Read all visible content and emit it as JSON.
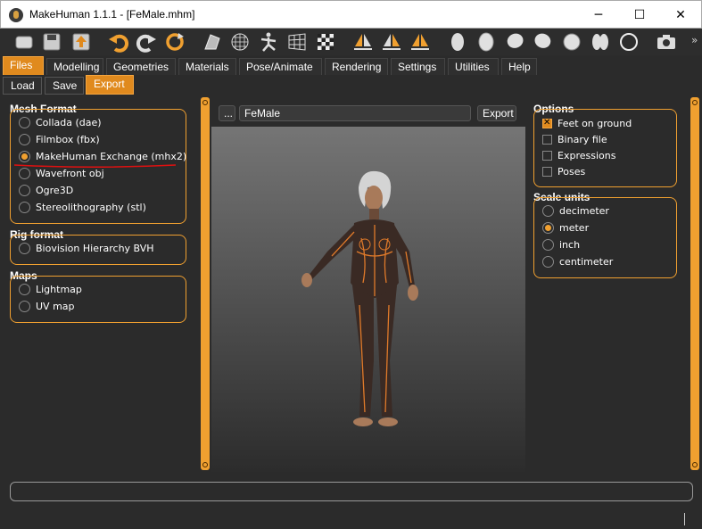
{
  "window": {
    "title": "MakeHuman 1.1.1 - [FeMale.mhm]",
    "controls": {
      "minimize": "─",
      "maximize": "☐",
      "close": "✕"
    }
  },
  "toolbar": {
    "icons": [
      "new-file",
      "save-file",
      "export-file",
      "undo",
      "redo",
      "reset",
      "wireframe",
      "grid-mesh",
      "skeleton-pose",
      "perspective-grid",
      "checker-pattern",
      "symmetry-right",
      "symmetry-left",
      "symmetry",
      "face-front",
      "face-side",
      "head-left",
      "head-right",
      "head-top",
      "head-back",
      "head-outline",
      "camera"
    ],
    "overflow": "»"
  },
  "tabs": [
    "Files",
    "Modelling",
    "Geometries",
    "Materials",
    "Pose/Animate",
    "Rendering",
    "Settings",
    "Utilities",
    "Help"
  ],
  "subtabs": [
    "Load",
    "Save",
    "Export"
  ],
  "mesh_format": {
    "title": "Mesh Format",
    "options": [
      "Collada (dae)",
      "Filmbox (fbx)",
      "MakeHuman Exchange (mhx2)",
      "Wavefront obj",
      "Ogre3D",
      "Stereolithography (stl)"
    ],
    "selected": 2
  },
  "rig_format": {
    "title": "Rig format",
    "options": [
      "Biovision Hierarchy BVH"
    ]
  },
  "maps": {
    "title": "Maps",
    "options": [
      "Lightmap",
      "UV map"
    ]
  },
  "export_bar": {
    "browse_label": "...",
    "filename": "FeMale",
    "export_label": "Export"
  },
  "options": {
    "title": "Options",
    "items": [
      {
        "label": "Feet on ground",
        "checked": true
      },
      {
        "label": "Binary file",
        "checked": false
      },
      {
        "label": "Expressions",
        "checked": false
      },
      {
        "label": "Poses",
        "checked": false
      }
    ]
  },
  "scale_units": {
    "title": "Scale units",
    "options": [
      "decimeter",
      "meter",
      "inch",
      "centimeter"
    ],
    "selected": 1
  },
  "colors": {
    "accent": "#f0a030",
    "annotation": "#e01010",
    "background": "#2b2b2b"
  }
}
